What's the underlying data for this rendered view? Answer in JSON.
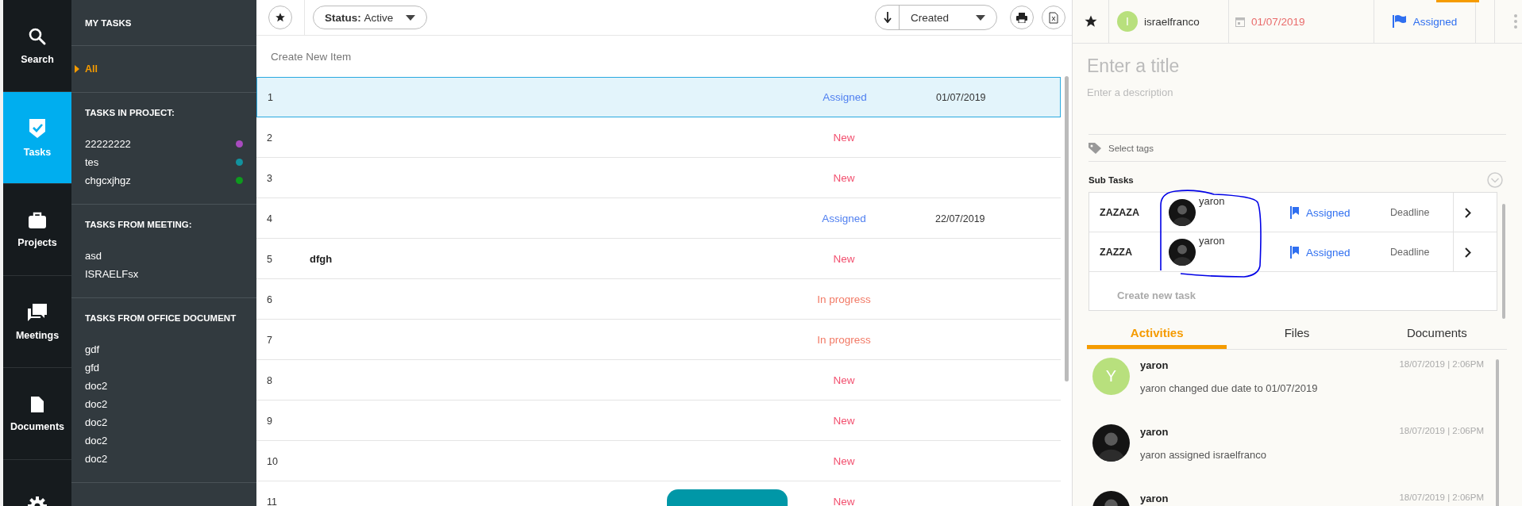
{
  "nav": [
    {
      "kind": "search",
      "label": "Search",
      "selected": false
    },
    {
      "kind": "tasks",
      "label": "Tasks",
      "selected": true
    },
    {
      "kind": "projects",
      "label": "Projects",
      "selected": false
    },
    {
      "kind": "meetings",
      "label": "Meetings",
      "selected": false
    },
    {
      "kind": "documents",
      "label": "Documents",
      "selected": false
    },
    {
      "kind": "settings",
      "selected": false
    }
  ],
  "sidebar": {
    "heading": "MY TASKS",
    "filters": [
      {
        "label": "All",
        "selected": true
      }
    ],
    "sections": [
      {
        "heading": "TASKS IN PROJECT:",
        "items": [
          {
            "label": "22222222",
            "color": "#a84bbf"
          },
          {
            "label": "tes",
            "color": "#12929e"
          },
          {
            "label": "chgcxjhgz",
            "color": "#0e9a1e"
          }
        ]
      },
      {
        "heading": "TASKS FROM MEETING:",
        "items": [
          {
            "label": "asd"
          },
          {
            "label": "ISRAELFsx"
          }
        ]
      },
      {
        "heading": "TASKS FROM OFFICE DOCUMENT",
        "items": [
          {
            "label": "gdf"
          },
          {
            "label": "gfd"
          },
          {
            "label": "doc2"
          },
          {
            "label": "doc2"
          },
          {
            "label": "doc2"
          },
          {
            "label": "doc2"
          },
          {
            "label": "doc2"
          }
        ]
      }
    ]
  },
  "toolbar": {
    "status_label": "Status:",
    "status_value": "Active",
    "sort_value": "Created"
  },
  "new_item": {
    "placeholder": "Create New Item"
  },
  "rows": [
    {
      "number": "1",
      "status": "Assigned",
      "color": "#4f7ff0",
      "date": "01/07/2019",
      "selected": true
    },
    {
      "number": "2",
      "status": "New",
      "color": "#f2506f",
      "selected": false
    },
    {
      "number": "3",
      "status": "New",
      "color": "#f2506f",
      "selected": false
    },
    {
      "number": "4",
      "status": "Assigned",
      "color": "#4f7ff0",
      "date": "22/07/2019",
      "selected": false
    },
    {
      "number": "5",
      "title": "dfgh",
      "status": "New",
      "color": "#f2506f",
      "selected": false
    },
    {
      "number": "6",
      "status": "In progress",
      "color": "#f27a66",
      "selected": false
    },
    {
      "number": "7",
      "status": "In progress",
      "color": "#f27a66",
      "selected": false
    },
    {
      "number": "8",
      "status": "New",
      "color": "#f2506f",
      "selected": false
    },
    {
      "number": "9",
      "status": "New",
      "color": "#f2506f",
      "selected": false
    },
    {
      "number": "10",
      "status": "New",
      "color": "#f2506f",
      "selected": false
    },
    {
      "number": "11",
      "status": "New",
      "color": "#f2506f",
      "selected": false
    }
  ],
  "detail": {
    "assignee": {
      "initial": "I",
      "name": "israelfranco"
    },
    "due_date": "01/07/2019",
    "status": "Assigned",
    "title": {
      "placeholder": "Enter a title"
    },
    "description": {
      "placeholder": "Enter a description"
    },
    "tags": {
      "placeholder": "Select tags"
    },
    "subtasks_heading": "Sub Tasks",
    "subtasks": [
      {
        "title": "ZAZAZA",
        "assignee": "yaron",
        "status": "Assigned",
        "deadline": "Deadline"
      },
      {
        "title": "ZAZZA",
        "assignee": "yaron",
        "status": "Assigned",
        "deadline": "Deadline"
      }
    ],
    "new_subtask": {
      "placeholder": "Create new task"
    },
    "tabs": [
      {
        "label": "Activities",
        "selected": true
      },
      {
        "label": "Files",
        "selected": false
      },
      {
        "label": "Documents",
        "selected": false
      }
    ],
    "activities": [
      {
        "kind": "initial",
        "initial": "Y",
        "name": "yaron",
        "time": "18/07/2019 | 2:06PM",
        "message": "yaron changed due date to 01/07/2019"
      },
      {
        "kind": "photo",
        "name": "yaron",
        "time": "18/07/2019 | 2:06PM",
        "message": "yaron assigned israelfranco"
      },
      {
        "kind": "photo",
        "name": "yaron",
        "time": "18/07/2019 | 2:06PM"
      }
    ]
  }
}
